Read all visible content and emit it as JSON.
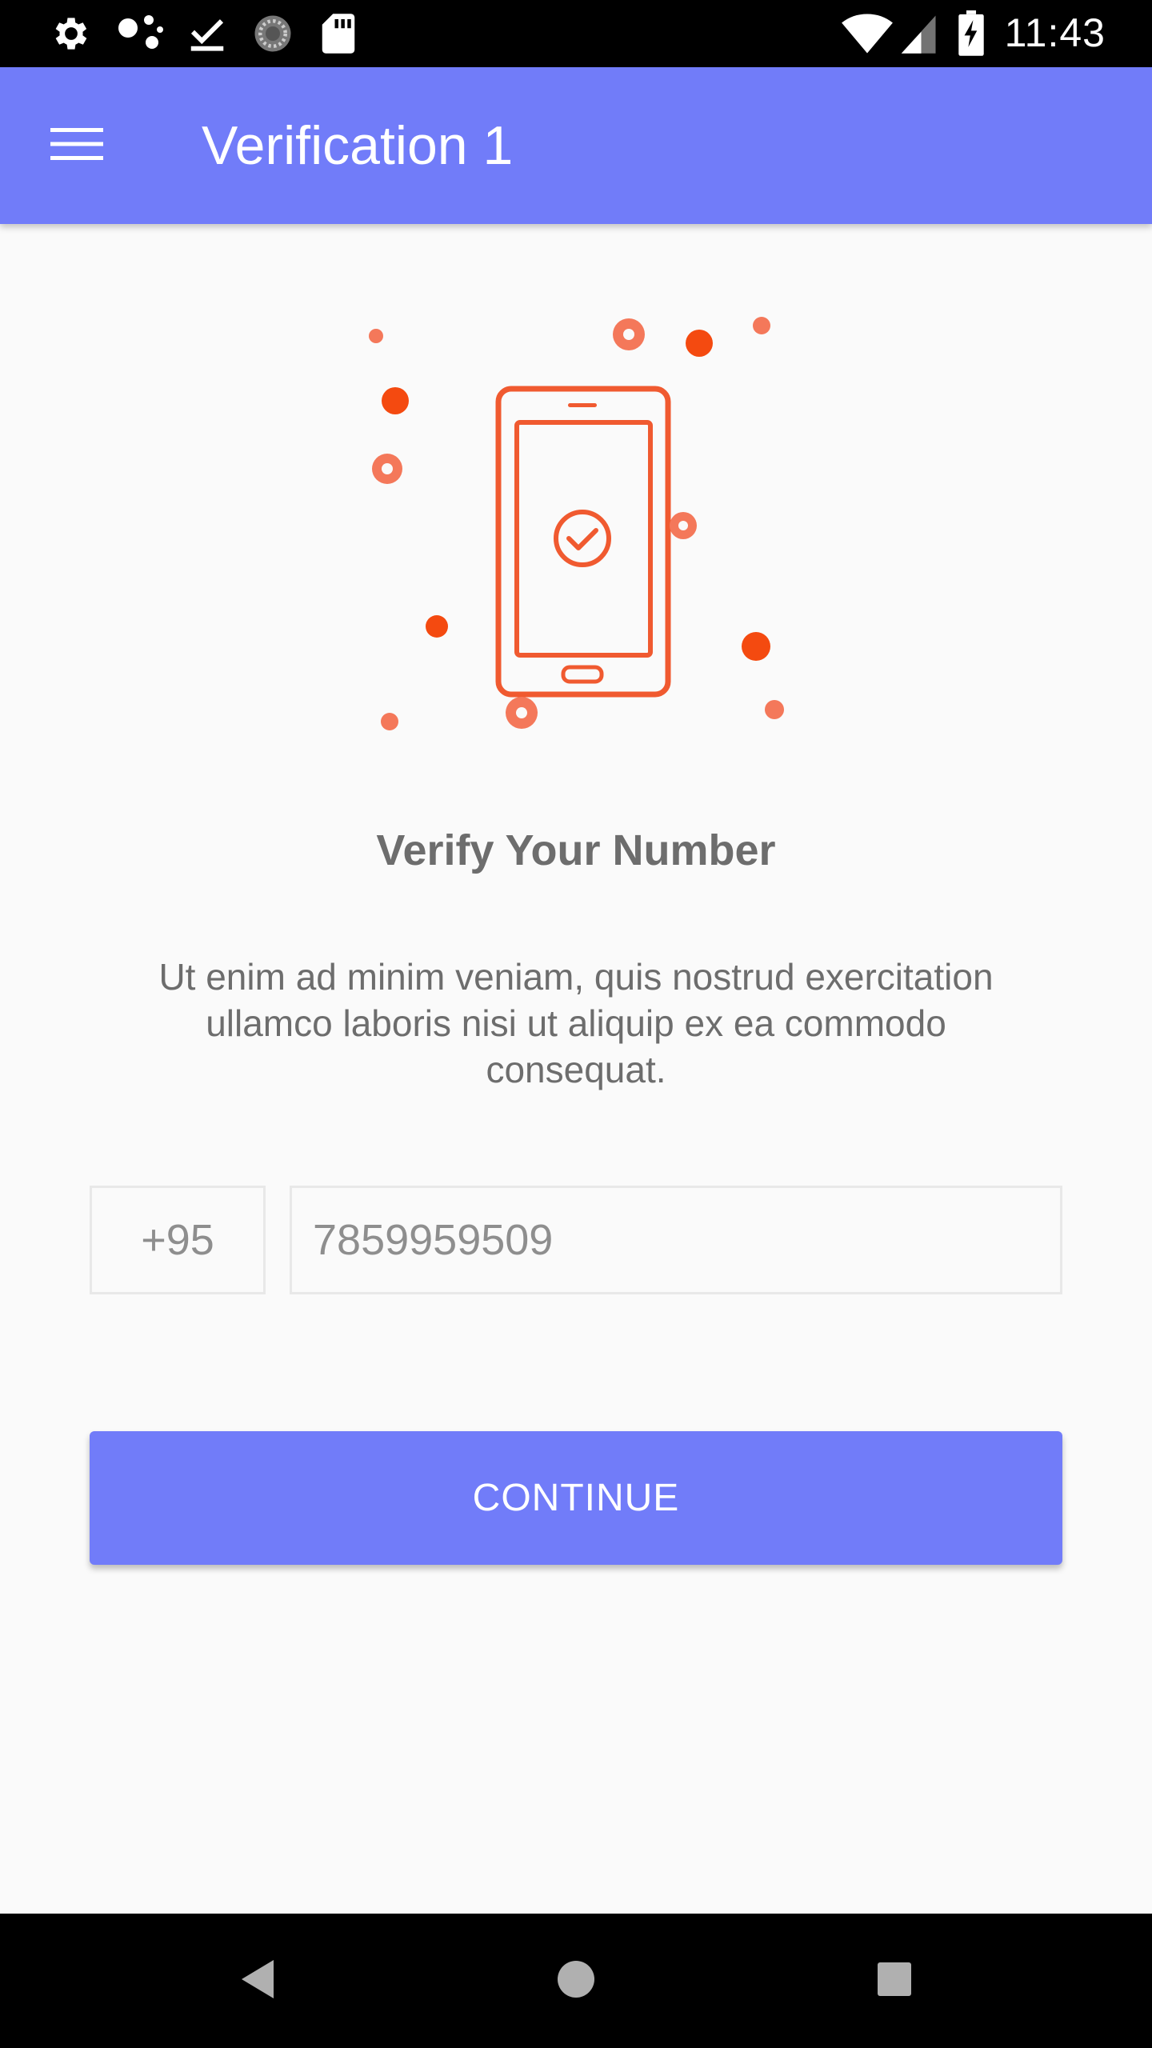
{
  "status_bar": {
    "time": "11:43",
    "left_icons": [
      "settings-icon",
      "dots-icon",
      "download-done-icon",
      "sync-icon",
      "sd-card-icon"
    ],
    "right_icons": [
      "wifi-icon",
      "signal-icon",
      "battery-charging-icon"
    ]
  },
  "app_bar": {
    "title": "Verification 1",
    "menu_icon": "menu-icon",
    "color": "#717cf9"
  },
  "illustration": {
    "icon": "phone-verified-icon",
    "accent_color": "#f05a30",
    "dot_color": "#f44a10"
  },
  "content": {
    "heading": "Verify Your Number",
    "description": "Ut enim ad minim veniam, quis nostrud exercitation ullamco laboris nisi ut aliquip ex ea commodo consequat."
  },
  "form": {
    "country_code": "+95",
    "phone_placeholder": "7859959509"
  },
  "actions": {
    "continue_label": "CONTINUE"
  },
  "nav_bar": {
    "icons": [
      "back-icon",
      "home-icon",
      "recents-icon"
    ]
  }
}
